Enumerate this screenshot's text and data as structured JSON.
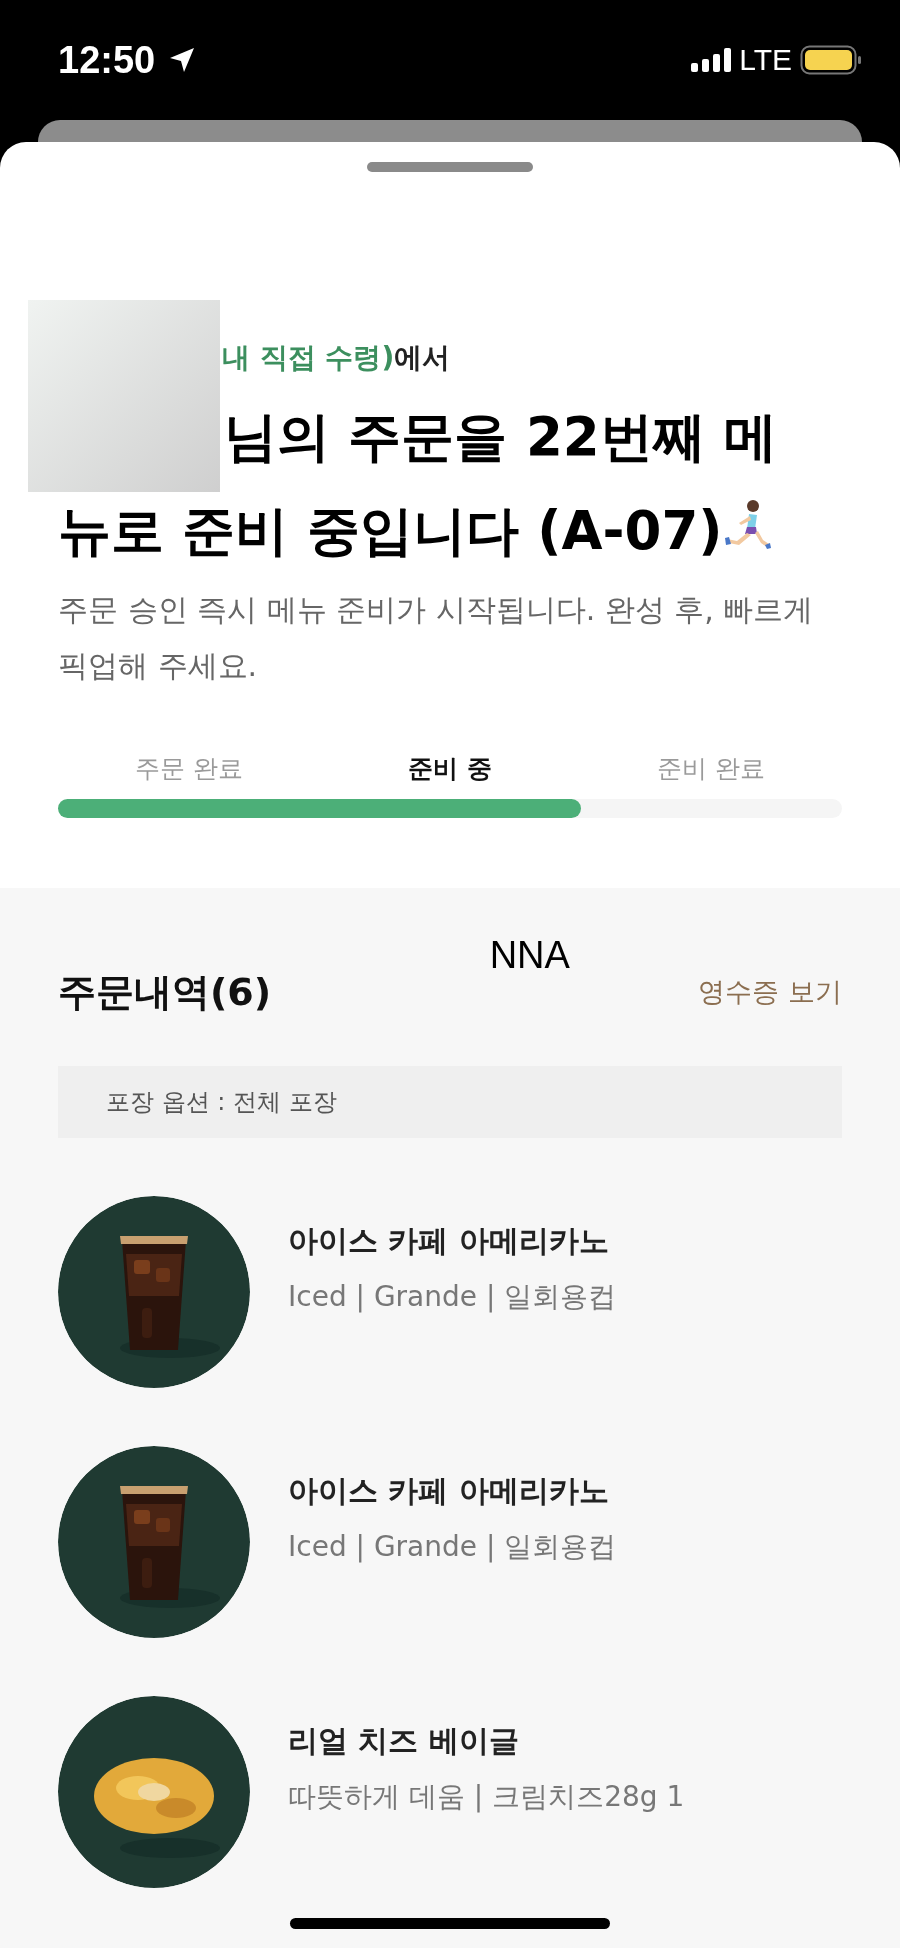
{
  "status_bar": {
    "time": "12:50",
    "network": "LTE"
  },
  "pickup": {
    "store": "내 직접 수령)",
    "suffix": "에서",
    "redacted": true
  },
  "headline": "님의 주문을 22번째 메뉴로 준비 중입니다 (A-07)",
  "description": "주문 승인 즉시 메뉴 준비가 시작됩니다. 완성 후, 빠르게 픽업해 주세요.",
  "steps": [
    {
      "label": "주문 완료",
      "selected": false
    },
    {
      "label": "준비 중",
      "selected": true
    },
    {
      "label": "준비 완료",
      "selected": false
    }
  ],
  "progress": {
    "level": 0.667
  },
  "order": {
    "title": "주문내역(6)",
    "overlay_text": "NNA",
    "receipt_link": "영수증 보기",
    "packing": "포장 옵션 : 전체 포장",
    "items": [
      {
        "kind": "drink",
        "name": "아이스 카페 아메리카노",
        "options": "Iced | Grande | 일회용컵"
      },
      {
        "kind": "drink",
        "name": "아이스 카페 아메리카노",
        "options": "Iced | Grande | 일회용컵"
      },
      {
        "kind": "food",
        "name": "리얼 치즈 베이글",
        "options": "따뜻하게 데움 | 크림치즈28g 1"
      }
    ]
  }
}
